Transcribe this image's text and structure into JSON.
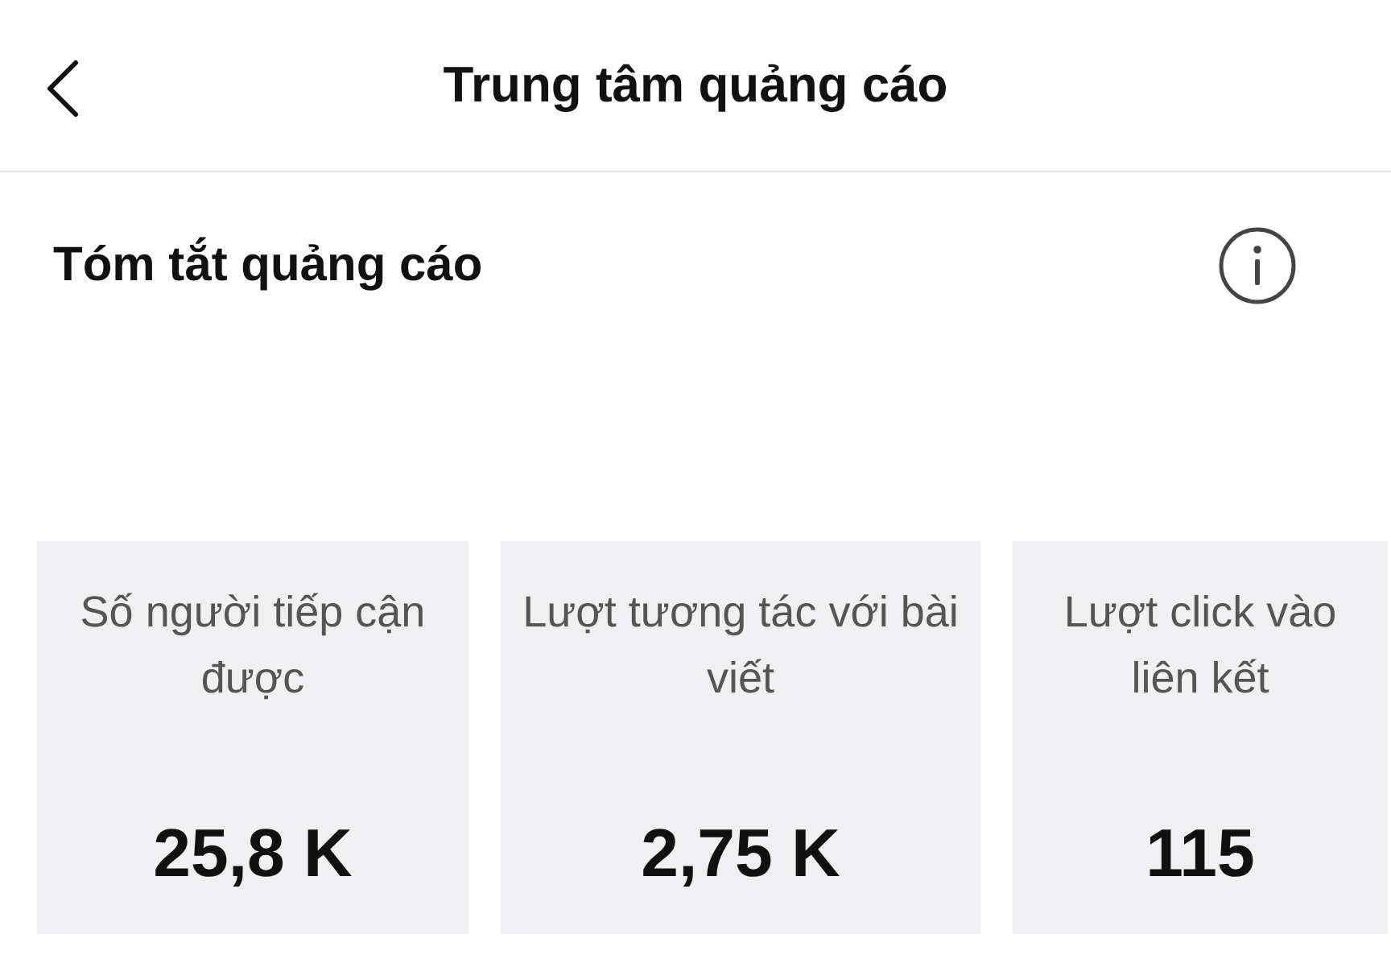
{
  "header": {
    "title": "Trung tâm quảng cáo"
  },
  "summary": {
    "title": "Tóm tắt quảng cáo"
  },
  "stats": [
    {
      "label": "Số người tiếp cận được",
      "value": "25,8 K"
    },
    {
      "label": "Lượt tương tác với bài viết",
      "value": "2,75 K"
    },
    {
      "label": "Lượt click vào liên kết",
      "value": "115"
    }
  ]
}
